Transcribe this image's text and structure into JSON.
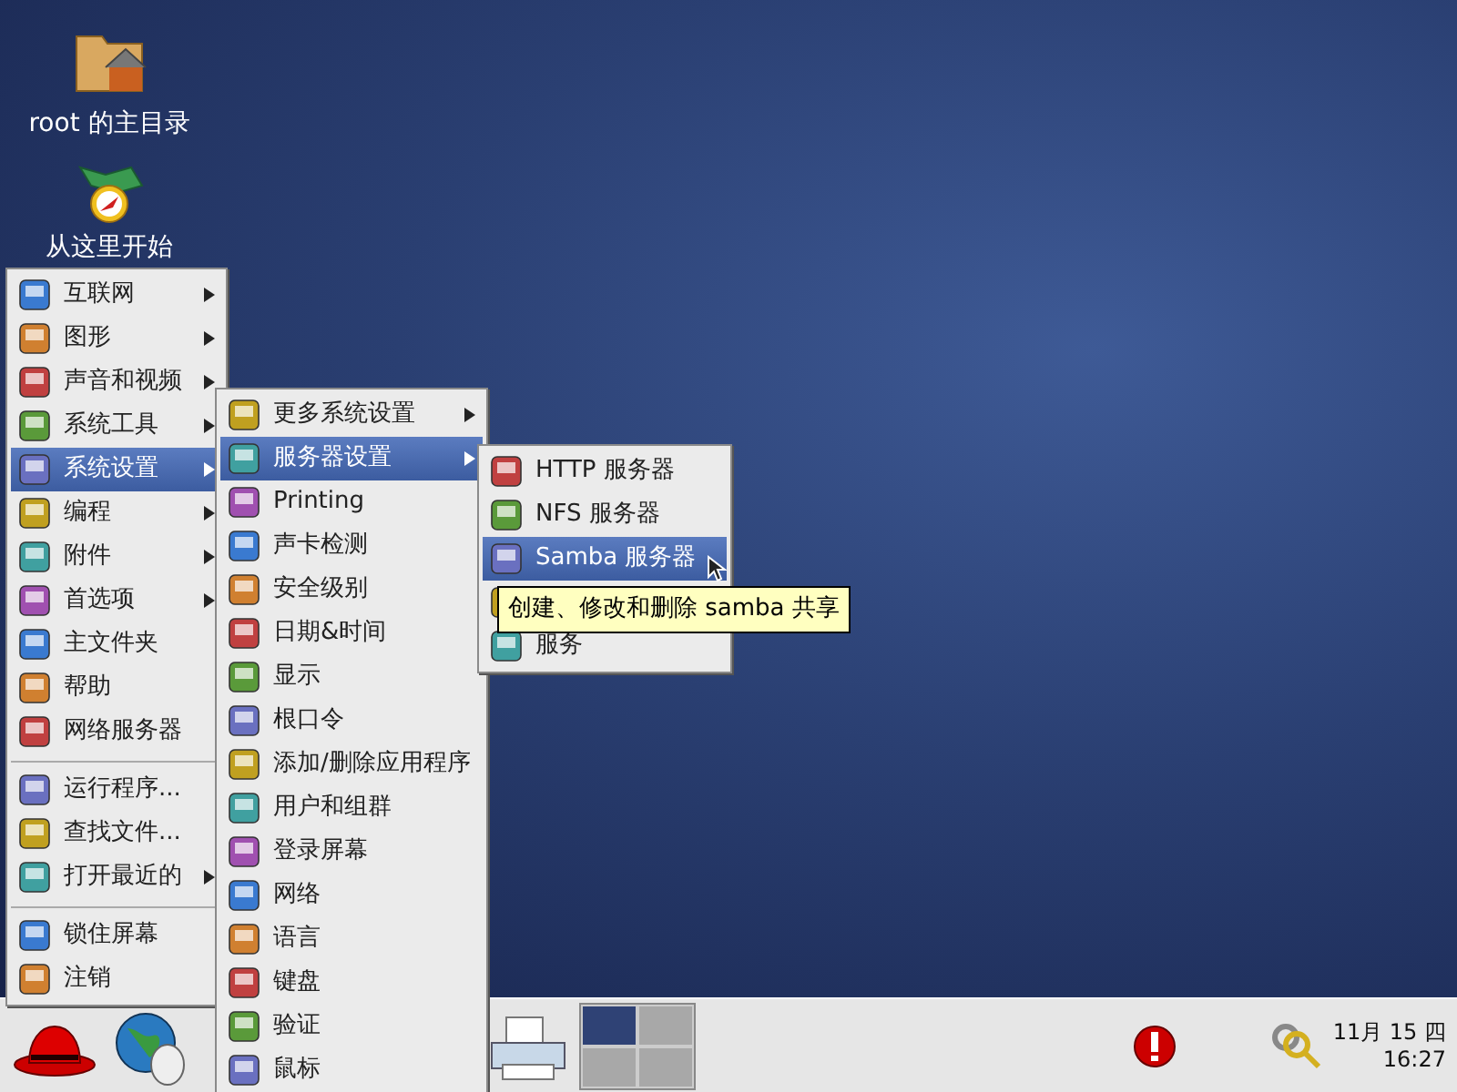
{
  "desktop_icons": [
    {
      "label": "root 的主目录",
      "kind": "home"
    },
    {
      "label": "从这里开始",
      "kind": "start"
    }
  ],
  "menus": [
    {
      "items": [
        {
          "kind": "item",
          "label": "互联网",
          "submenu": true,
          "selected": false
        },
        {
          "kind": "item",
          "label": "图形",
          "submenu": true,
          "selected": false
        },
        {
          "kind": "item",
          "label": "声音和视频",
          "submenu": true,
          "selected": false
        },
        {
          "kind": "item",
          "label": "系统工具",
          "submenu": true,
          "selected": false
        },
        {
          "kind": "item",
          "label": "系统设置",
          "submenu": true,
          "selected": true
        },
        {
          "kind": "item",
          "label": "编程",
          "submenu": true,
          "selected": false
        },
        {
          "kind": "item",
          "label": "附件",
          "submenu": true,
          "selected": false
        },
        {
          "kind": "item",
          "label": "首选项",
          "submenu": true,
          "selected": false
        },
        {
          "kind": "item",
          "label": "主文件夹",
          "submenu": false,
          "selected": false
        },
        {
          "kind": "item",
          "label": "帮助",
          "submenu": false,
          "selected": false
        },
        {
          "kind": "item",
          "label": "网络服务器",
          "submenu": false,
          "selected": false
        },
        {
          "kind": "separator"
        },
        {
          "kind": "item",
          "label": "运行程序...",
          "submenu": false,
          "selected": false
        },
        {
          "kind": "item",
          "label": "查找文件...",
          "submenu": false,
          "selected": false
        },
        {
          "kind": "item",
          "label": "打开最近的",
          "submenu": true,
          "selected": false
        },
        {
          "kind": "separator"
        },
        {
          "kind": "item",
          "label": "锁住屏幕",
          "submenu": false,
          "selected": false
        },
        {
          "kind": "item",
          "label": "注销",
          "submenu": false,
          "selected": false
        }
      ]
    },
    {
      "items": [
        {
          "kind": "item",
          "label": "更多系统设置",
          "submenu": true,
          "selected": false
        },
        {
          "kind": "item",
          "label": "服务器设置",
          "submenu": true,
          "selected": true
        },
        {
          "kind": "item",
          "label": "Printing",
          "submenu": false,
          "selected": false
        },
        {
          "kind": "item",
          "label": "声卡检测",
          "submenu": false,
          "selected": false
        },
        {
          "kind": "item",
          "label": "安全级别",
          "submenu": false,
          "selected": false
        },
        {
          "kind": "item",
          "label": "日期&时间",
          "submenu": false,
          "selected": false
        },
        {
          "kind": "item",
          "label": "显示",
          "submenu": false,
          "selected": false
        },
        {
          "kind": "item",
          "label": "根口令",
          "submenu": false,
          "selected": false
        },
        {
          "kind": "item",
          "label": "添加/删除应用程序",
          "submenu": false,
          "selected": false
        },
        {
          "kind": "item",
          "label": "用户和组群",
          "submenu": false,
          "selected": false
        },
        {
          "kind": "item",
          "label": "登录屏幕",
          "submenu": false,
          "selected": false
        },
        {
          "kind": "item",
          "label": "网络",
          "submenu": false,
          "selected": false
        },
        {
          "kind": "item",
          "label": "语言",
          "submenu": false,
          "selected": false
        },
        {
          "kind": "item",
          "label": "键盘",
          "submenu": false,
          "selected": false
        },
        {
          "kind": "item",
          "label": "验证",
          "submenu": false,
          "selected": false
        },
        {
          "kind": "item",
          "label": "鼠标",
          "submenu": false,
          "selected": false
        }
      ]
    },
    {
      "items": [
        {
          "kind": "item",
          "label": "HTTP 服务器",
          "submenu": false,
          "selected": false
        },
        {
          "kind": "item",
          "label": "NFS 服务器",
          "submenu": false,
          "selected": false
        },
        {
          "kind": "item",
          "label": "Samba 服务器",
          "submenu": false,
          "selected": true
        },
        {
          "kind": "covered"
        },
        {
          "kind": "item",
          "label": "服务",
          "submenu": false,
          "selected": false
        }
      ]
    }
  ],
  "tooltip": {
    "text": "创建、修改和删除 samba 共享"
  },
  "taskbar": {
    "workspaces": [
      {
        "selected": true
      },
      {
        "selected": false
      },
      {
        "selected": false
      },
      {
        "selected": false
      }
    ],
    "clock": {
      "date": "11月 15 四",
      "time": "16:27"
    }
  }
}
